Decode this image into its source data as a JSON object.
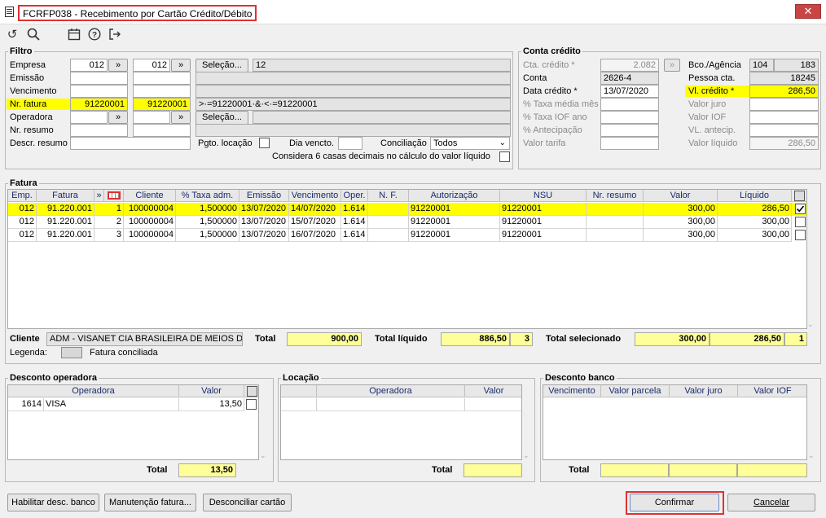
{
  "window": {
    "title": "FCRFP038 - Recebimento por Cartão Crédito/Débito",
    "close": "✕"
  },
  "filtro": {
    "title": "Filtro",
    "empresa_label": "Empresa",
    "empresa_from": "012",
    "empresa_to": "012",
    "emissao_label": "Emissão",
    "vencimento_label": "Vencimento",
    "nr_fatura_label": "Nr. fatura",
    "nr_fatura_from": "91220001",
    "nr_fatura_to": "91220001",
    "operadora_label": "Operadora",
    "nr_resumo_label": "Nr. resumo",
    "descr_resumo_label": "Descr. resumo",
    "selecao_label": "Seleção...",
    "selecao_value": "12",
    "expr_value": ">·=91220001·&·<·=91220001",
    "pgto_locacao_label": "Pgto. locação",
    "dia_vencto_label": "Dia vencto.",
    "conciliacao_label": "Conciliação",
    "conciliacao_value": "Todos",
    "considera_label": "Considera 6 casas decimais no cálculo do valor líquido",
    "arrow": "»"
  },
  "conta": {
    "title": "Conta crédito",
    "cta_credito_label": "Cta. crédito *",
    "cta_credito_value": "2.082",
    "conta_label": "Conta",
    "conta_value": "2626-4",
    "data_credito_label": "Data crédito *",
    "data_credito_value": "13/07/2020",
    "taxa_media_label": "% Taxa média mês",
    "taxa_iof_label": "% Taxa IOF ano",
    "antecipacao_label": "% Antecipação",
    "valor_tarifa_label": "Valor tarifa",
    "bco_agencia_label": "Bco./Agência",
    "bco_value": "104",
    "agencia_value": "183",
    "pessoa_cta_label": "Pessoa cta.",
    "pessoa_cta_value": "18245",
    "vl_credito_label": "Vl. crédito *",
    "vl_credito_value": "286,50",
    "valor_juro_label": "Valor juro",
    "valor_iof_label": "Valor IOF",
    "vl_antecip_label": "VL. antecip.",
    "valor_liquido_label": "Valor líquido",
    "valor_liquido_value": "286,50"
  },
  "fatura": {
    "title": "Fatura",
    "headers": {
      "emp": "Emp.",
      "fatura": "Fatura",
      "arrow": "»",
      "cliente": "Cliente",
      "taxa": "% Taxa adm.",
      "emissao": "Emissão",
      "vencimento": "Vencimento",
      "oper": "Oper.",
      "nf": "N. F.",
      "autorizacao": "Autorização",
      "nsu": "NSU",
      "nr_resumo": "Nr. resumo",
      "valor": "Valor",
      "liquido": "Líquido"
    },
    "rows": [
      {
        "emp": "012",
        "fatura": "91.220.001",
        "parc": "1",
        "cliente": "100000004",
        "taxa": "1,500000",
        "emissao": "13/07/2020",
        "vencimento": "14/07/2020",
        "oper": "1.614",
        "nf": "",
        "autorizacao": "91220001",
        "nsu": "91220001",
        "nr_resumo": "",
        "valor": "300,00",
        "liquido": "286,50",
        "checked": true
      },
      {
        "emp": "012",
        "fatura": "91.220.001",
        "parc": "2",
        "cliente": "100000004",
        "taxa": "1,500000",
        "emissao": "13/07/2020",
        "vencimento": "15/07/2020",
        "oper": "1.614",
        "nf": "",
        "autorizacao": "91220001",
        "nsu": "91220001",
        "nr_resumo": "",
        "valor": "300,00",
        "liquido": "300,00",
        "checked": false
      },
      {
        "emp": "012",
        "fatura": "91.220.001",
        "parc": "3",
        "cliente": "100000004",
        "taxa": "1,500000",
        "emissao": "13/07/2020",
        "vencimento": "16/07/2020",
        "oper": "1.614",
        "nf": "",
        "autorizacao": "91220001",
        "nsu": "91220001",
        "nr_resumo": "",
        "valor": "300,00",
        "liquido": "300,00",
        "checked": false
      }
    ],
    "cliente_label": "Cliente",
    "cliente_value": "ADM - VISANET CIA BRASILEIRA DE MEIOS DE PA",
    "total_label": "Total",
    "total_value": "900,00",
    "total_liquido_label": "Total líquido",
    "total_liquido_value": "886,50",
    "total_liquido_count": "3",
    "total_selecionado_label": "Total selecionado",
    "total_sel_valor": "300,00",
    "total_sel_liquido": "286,50",
    "total_sel_count": "1",
    "legenda_label": "Legenda:",
    "fatura_conciliada_label": "Fatura conciliada"
  },
  "desconto_operadora": {
    "title": "Desconto operadora",
    "headers": {
      "operadora": "Operadora",
      "valor": "Valor"
    },
    "rows": [
      {
        "codigo": "1614",
        "nome": "VISA",
        "valor": "13,50"
      }
    ],
    "total_label": "Total",
    "total_value": "13,50"
  },
  "locacao": {
    "title": "Locação",
    "headers": {
      "operadora": "Operadora",
      "valor": "Valor"
    },
    "total_label": "Total"
  },
  "desconto_banco": {
    "title": "Desconto banco",
    "headers": {
      "vencimento": "Vencimento",
      "valor_parcela": "Valor parcela",
      "valor_juro": "Valor juro",
      "valor_iof": "Valor IOF"
    },
    "total_label": "Total"
  },
  "buttons": {
    "habilitar": "Habilitar desc. banco",
    "manutencao": "Manutenção fatura...",
    "desconciliar": "Desconciliar cartão",
    "confirmar": "Confirmar",
    "cancelar": "Cancelar"
  },
  "colors": {
    "highlight": "#ffff00",
    "accent_red": "#e03030",
    "readonly": "#e4e4e4",
    "total_yellow": "#ffff99"
  }
}
